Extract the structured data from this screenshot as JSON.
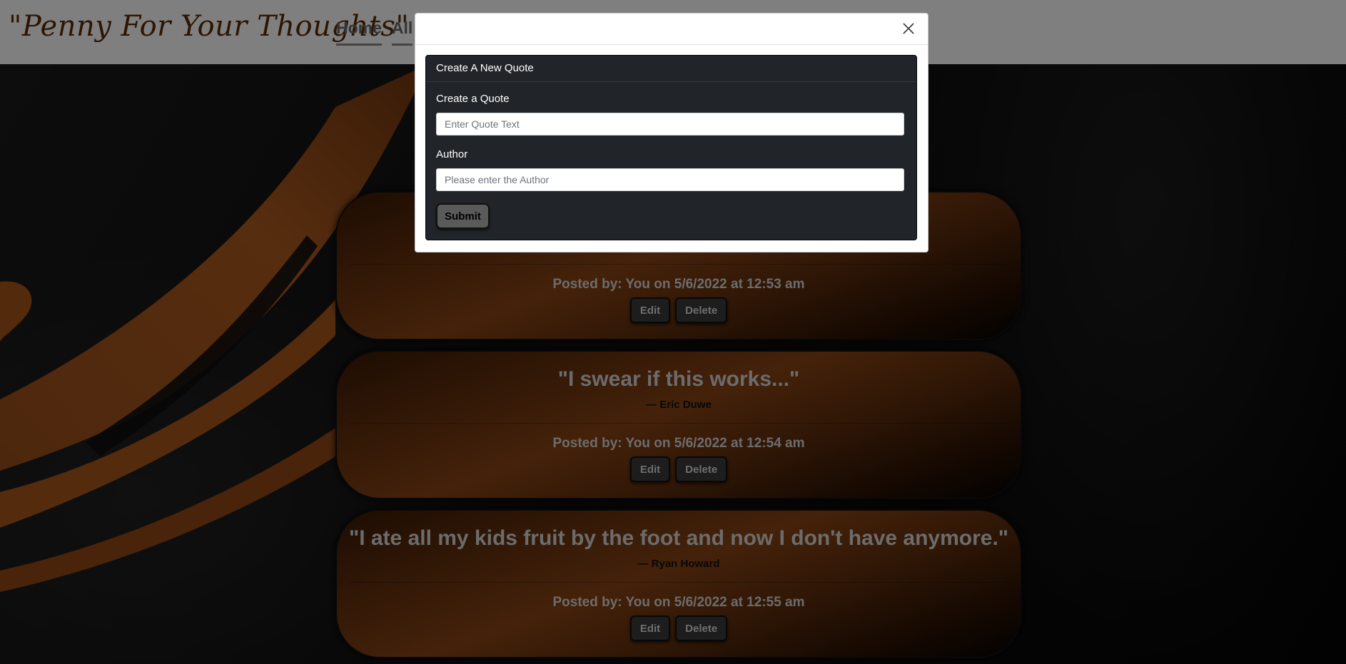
{
  "navbar": {
    "brand": "\"Penny For Your Thoughts\"",
    "links": [
      "Home",
      "All"
    ]
  },
  "quotes": [
    {
      "text": "",
      "author": "",
      "posted": "Posted by: You on 5/6/2022 at 12:53 am",
      "edit_label": "Edit",
      "delete_label": "Delete"
    },
    {
      "text": "\"I swear if this works...\"",
      "author": "— Eric Duwe",
      "posted": "Posted by: You on 5/6/2022 at 12:54 am",
      "edit_label": "Edit",
      "delete_label": "Delete"
    },
    {
      "text": "\"I ate all my kids fruit by the foot and now I don't have anymore.\"",
      "author": "— Ryan Howard",
      "posted": "Posted by: You on 5/6/2022 at 12:55 am",
      "edit_label": "Edit",
      "delete_label": "Delete"
    }
  ],
  "modal": {
    "close_icon": "close-icon",
    "form": {
      "title": "Create A New Quote",
      "quote_label": "Create a Quote",
      "quote_placeholder": "Enter Quote Text",
      "quote_value": "",
      "author_label": "Author",
      "author_placeholder": "Please enter the Author",
      "author_value": "",
      "submit_label": "Submit"
    }
  },
  "colors": {
    "accent_orange": "#8a4414",
    "brand_text": "#5a2a05",
    "form_bg": "#212529"
  }
}
